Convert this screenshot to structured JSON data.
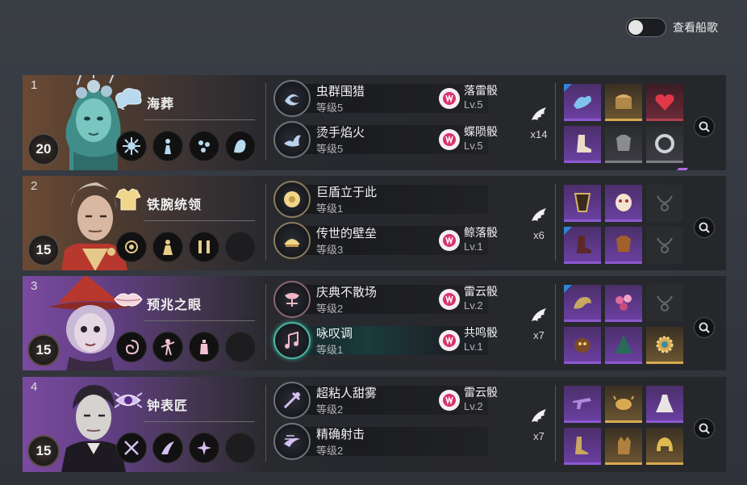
{
  "toggle": {
    "label": "查看船歌",
    "state": "off"
  },
  "rows": [
    {
      "rank": "1",
      "level": "20",
      "role": "海葬",
      "tint": "brown",
      "skills": [
        {
          "name": "虫群围猎",
          "level": "等级5",
          "dice": "落雷骰",
          "dice_level": "Lv.5"
        },
        {
          "name": "烫手焰火",
          "level": "等级5",
          "dice": "蝶陨骰",
          "dice_level": "Lv.5"
        }
      ],
      "count": "x14"
    },
    {
      "rank": "2",
      "level": "15",
      "role": "铁腕统领",
      "tint": "brown",
      "skills": [
        {
          "name": "巨盾立于此",
          "level": "等级1",
          "dice": "",
          "dice_level": ""
        },
        {
          "name": "传世的壁垒",
          "level": "等级3",
          "dice": "鲸落骰",
          "dice_level": "Lv.1"
        }
      ],
      "count": "x6"
    },
    {
      "rank": "3",
      "level": "15",
      "role": "预兆之眼",
      "tint": "purple",
      "skills": [
        {
          "name": "庆典不散场",
          "level": "等级2",
          "dice": "雷云骰",
          "dice_level": "Lv.2"
        },
        {
          "name": "咏叹调",
          "level": "等级1",
          "dice": "共鸣骰",
          "dice_level": "Lv.1"
        }
      ],
      "count": "x7"
    },
    {
      "rank": "4",
      "level": "15",
      "role": "钟表匠",
      "tint": "purple",
      "skills": [
        {
          "name": "超粘人甜雾",
          "level": "等级2",
          "dice": "雷云骰",
          "dice_level": "Lv.2"
        },
        {
          "name": "精确射击",
          "level": "等级2",
          "dice": "",
          "dice_level": ""
        }
      ],
      "count": "x7"
    }
  ],
  "colors": {
    "accent_purple": "#8d58d0",
    "accent_gold": "#d8a950",
    "teal": "#4ab6a4",
    "dice_pink": "#d8326a"
  }
}
